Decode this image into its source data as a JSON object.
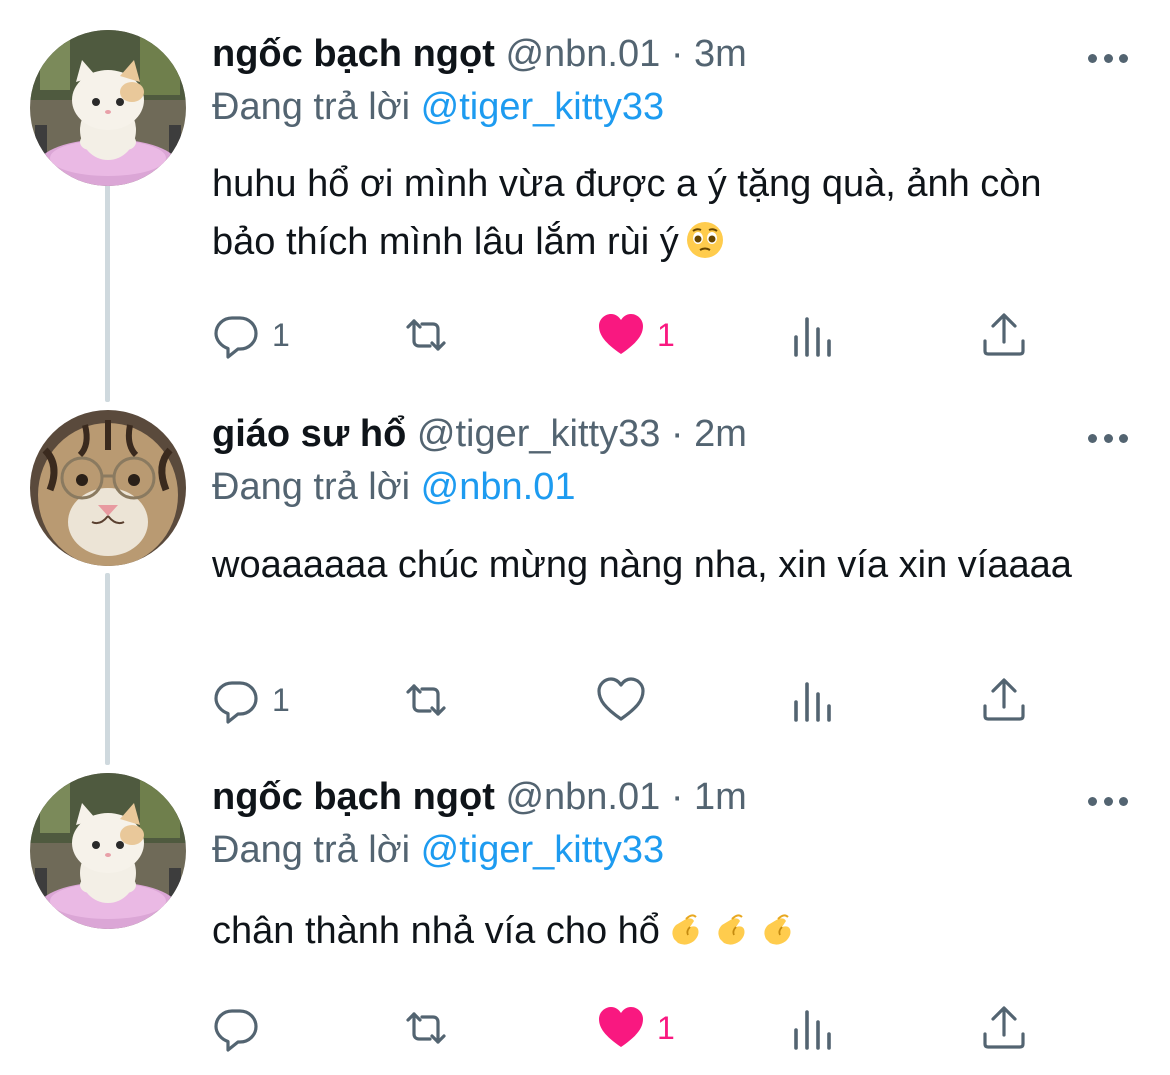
{
  "tweets": [
    {
      "display_name": "ngốc bạch ngọt",
      "handle": "@nbn.01",
      "separator": "·",
      "time": "3m",
      "replying_prefix": "Đang trả lời",
      "replying_to": "@tiger_kitty33",
      "text": "huhu hổ ơi mình vừa được a ý tặng quà, ảnh còn bảo thích mình lâu lắm rùi ý",
      "emoji": [
        "pleading-face"
      ],
      "reply_count": "1",
      "like_count": "1",
      "liked": true,
      "avatar": "cat-plush-avatar"
    },
    {
      "display_name": "giáo sư hổ",
      "handle": "@tiger_kitty33",
      "separator": "·",
      "time": "2m",
      "replying_prefix": "Đang trả lời",
      "replying_to": "@nbn.01",
      "text": "woaaaaaa chúc mừng nàng nha, xin vía xin víaaaa",
      "emoji": [],
      "reply_count": "1",
      "like_count": "",
      "liked": false,
      "avatar": "tiger-plush-avatar"
    },
    {
      "display_name": "ngốc bạch ngọt",
      "handle": "@nbn.01",
      "separator": "·",
      "time": "1m",
      "replying_prefix": "Đang trả lời",
      "replying_to": "@tiger_kitty33",
      "text": "chân thành nhả vía cho hổ",
      "emoji": [
        "pinching-hand",
        "pinching-hand",
        "pinching-hand"
      ],
      "reply_count": "",
      "like_count": "1",
      "liked": true,
      "avatar": "cat-plush-avatar"
    }
  ],
  "colors": {
    "text": "#0f1419",
    "secondary": "#536471",
    "mention": "#1d9bf0",
    "like": "#f91880",
    "thread_line": "#cfd9de"
  },
  "icons": {
    "reply": "reply-icon",
    "retweet": "retweet-icon",
    "like": "heart-icon",
    "views": "views-icon",
    "share": "share-icon",
    "more": "more-icon"
  }
}
